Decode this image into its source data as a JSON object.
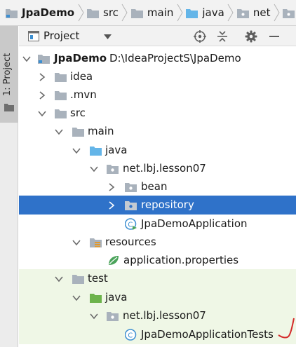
{
  "breadcrumbs": [
    {
      "label": "JpaDemo",
      "bold": true
    },
    {
      "label": "src",
      "bold": false
    },
    {
      "label": "main",
      "bold": false
    },
    {
      "label": "java",
      "bold": false
    },
    {
      "label": "net",
      "bold": false
    }
  ],
  "tool_stripe": {
    "label": "1: Project"
  },
  "toolbar": {
    "view_label": "Project"
  },
  "tree": {
    "root": {
      "label": "JpaDemo",
      "path": "D:\\IdeaProjectS\\JpaDemo"
    },
    "idea": "idea",
    "mvn": ".mvn",
    "src": "src",
    "main": "main",
    "main_java": "java",
    "main_pkg": "net.lbj.lesson07",
    "bean": "bean",
    "repository": "repository",
    "app_class": "JpaDemoApplication",
    "resources": "resources",
    "app_props": "application.properties",
    "test": "test",
    "test_java": "java",
    "test_pkg": "net.lbj.lesson07",
    "test_class": "JpaDemoApplicationTests"
  },
  "colors": {
    "selection": "#2f72c9",
    "test_background": "#eff7e6",
    "folder": "#a9b2bc",
    "source_folder": "#64b5e8",
    "test_folder": "#6cb34b"
  }
}
